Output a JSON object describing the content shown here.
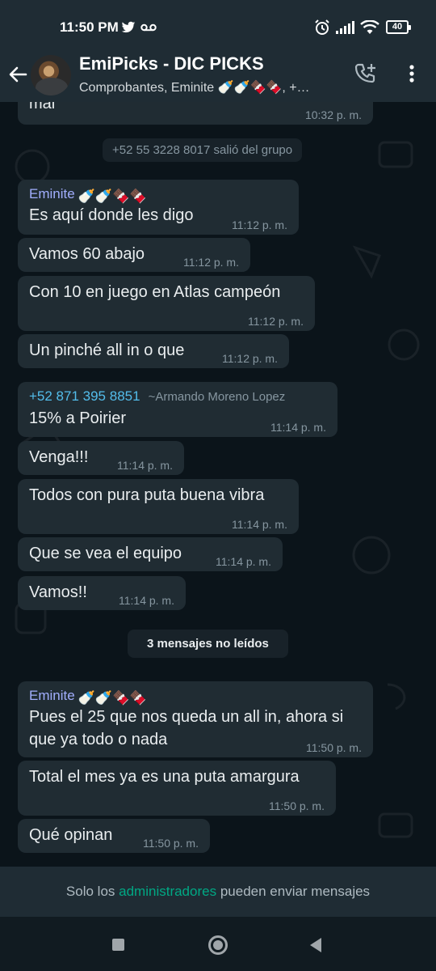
{
  "status_bar": {
    "time": "11:50 PM",
    "battery": "40",
    "icons": [
      "twitter-icon",
      "voicemail-icon",
      "alarm-icon",
      "signal-icon",
      "wifi-icon",
      "battery-icon"
    ]
  },
  "header": {
    "title": "EmiPicks - DIC PICKS",
    "subtitle": "Comprobantes, Eminite 🍼🍼🍫🍫, +…"
  },
  "system_message": "+52 55 3228 8017 salió del grupo",
  "unread_label": "3 mensajes no leídos",
  "messages": [
    {
      "text": "mal",
      "time": "10:32 p. m."
    },
    {
      "sender": "Eminite",
      "sender_emojis": "🍼🍼🍫🍫",
      "text": "Es aquí donde les digo",
      "time": "11:12 p. m."
    },
    {
      "text": "Vamos 60 abajo",
      "time": "11:12 p. m."
    },
    {
      "text": "Con 10 en juego en Atlas campeón",
      "time": "11:12 p. m."
    },
    {
      "text": "Un pinché all in o que",
      "time": "11:12 p. m."
    },
    {
      "sender": "+52 871 395 8851",
      "sender_alias": "~Armando Moreno Lopez",
      "text": "15% a Poirier",
      "time": "11:14 p. m."
    },
    {
      "text": "Venga!!!",
      "time": "11:14 p. m."
    },
    {
      "text": "Todos con pura puta buena vibra",
      "time": "11:14 p. m."
    },
    {
      "text": "Que se vea el equipo",
      "time": "11:14 p. m."
    },
    {
      "text": "Vamos!!",
      "time": "11:14 p. m."
    },
    {
      "sender": "Eminite",
      "sender_emojis": "🍼🍼🍫🍫",
      "text": "Pues el 25 que nos queda un all in, ahora si que ya todo o nada",
      "time": "11:50 p. m."
    },
    {
      "text": "Total el mes ya es una puta amargura",
      "time": "11:50 p. m."
    },
    {
      "text": "Qué opinan",
      "time": "11:50 p. m."
    }
  ],
  "footer": {
    "prefix": "Solo los",
    "link": "administradores",
    "suffix": "pueden enviar mensajes"
  },
  "colors": {
    "header_bg": "#1f2c34",
    "chat_bg": "#0b141a",
    "bubble_bg": "#202c33",
    "sender_name": "#a1aefd",
    "sender_phone": "#53bdeb",
    "accent_link": "#00a884"
  }
}
